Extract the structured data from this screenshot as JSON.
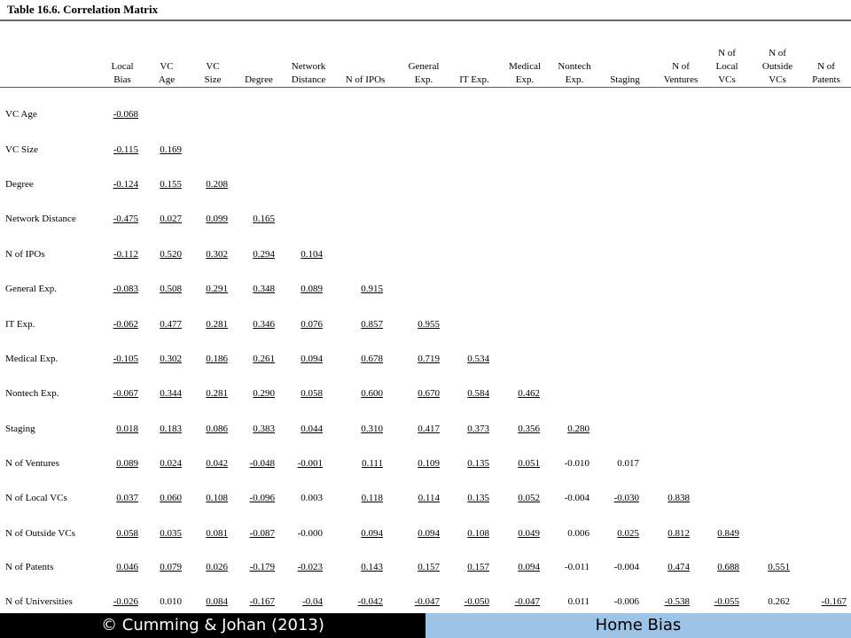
{
  "title": "Table 16.6. Correlation Matrix",
  "columns": [
    "Local\nBias",
    "VC\nAge",
    "VC\nSize",
    "Degree",
    "Network\nDistance",
    "N of IPOs",
    "General\nExp.",
    "IT Exp.",
    "Medical\nExp.",
    "Nontech\nExp.",
    "Staging",
    "N of\nVentures",
    "N of\nLocal\nVCs",
    "N of\nOutside\nVCs",
    "N of\nPatents"
  ],
  "rows": [
    {
      "label": "VC Age",
      "values": [
        "-0.068"
      ]
    },
    {
      "label": "VC Size",
      "values": [
        "-0.115",
        "0.169"
      ]
    },
    {
      "label": "Degree",
      "values": [
        "-0.124",
        "0.155",
        "0.208"
      ]
    },
    {
      "label": "Network Distance",
      "values": [
        "-0.475",
        "0.027",
        "0.099",
        "0.165"
      ]
    },
    {
      "label": "N of IPOs",
      "values": [
        "-0.112",
        "0.520",
        "0.302",
        "0.294",
        "0.104"
      ]
    },
    {
      "label": "General Exp.",
      "values": [
        "-0.083",
        "0.508",
        "0.291",
        "0.348",
        "0.089",
        "0.915"
      ]
    },
    {
      "label": "IT Exp.",
      "values": [
        "-0.062",
        "0.477",
        "0.281",
        "0.346",
        "0.076",
        "0.857",
        "0.955"
      ]
    },
    {
      "label": "Medical Exp.",
      "values": [
        "-0.105",
        "0.302",
        "0.186",
        "0.261",
        "0.094",
        "0.678",
        "0.719",
        "0.534"
      ]
    },
    {
      "label": "Nontech Exp.",
      "values": [
        "-0.067",
        "0.344",
        "0.281",
        "0.290",
        "0.058",
        "0.600",
        "0.670",
        "0.584",
        "0.462"
      ]
    },
    {
      "label": "Staging",
      "values": [
        "0.018",
        "0.183",
        "0.086",
        "0.383",
        "0.044",
        "0.310",
        "0.417",
        "0.373",
        "0.356",
        "0.280"
      ]
    },
    {
      "label": "N of Ventures",
      "values": [
        "0.089",
        "0.024",
        "0.042",
        "-0.048",
        "-0.001",
        "0.111",
        "0.109",
        "0.135",
        "0.051",
        "-0.010",
        "0.017"
      ]
    },
    {
      "label": "N of Local VCs",
      "values": [
        "0.037",
        "0.060",
        "0.108",
        "-0.096",
        "0.003",
        "0.118",
        "0.114",
        "0.135",
        "0.052",
        "-0.004",
        "-0.030",
        "0.838"
      ]
    },
    {
      "label": "N of Outside VCs",
      "values": [
        "0.058",
        "0.035",
        "0.081",
        "-0.087",
        "-0.000",
        "0.094",
        "0.094",
        "0.108",
        "0.049",
        "0.006",
        "0.025",
        "0.812",
        "0.849"
      ]
    },
    {
      "label": "N of Patents",
      "values": [
        "0.046",
        "0.079",
        "0.026",
        "-0.179",
        "-0.023",
        "0.143",
        "0.157",
        "0.157",
        "0.094",
        "-0.011",
        "-0.004",
        "0.474",
        "0.688",
        "0.551"
      ]
    },
    {
      "label": "N of Universities",
      "values": [
        "-0.026",
        "0.010",
        "0.084",
        "-0.167",
        "-0.04",
        "-0.042",
        "-0.047",
        "-0.050",
        "-0.047",
        "0.011",
        "-0.006",
        "-0.538",
        "-0.055",
        "0.262",
        "-0.167"
      ]
    }
  ],
  "not_underlined": [
    "10:9",
    "10:10",
    "11:4",
    "11:9",
    "12:4",
    "12:9",
    "13:9",
    "13:10",
    "14:1",
    "14:9",
    "14:10",
    "14:13"
  ],
  "footer": {
    "left": "© Cumming & Johan (2013)",
    "right": "Home Bias"
  }
}
